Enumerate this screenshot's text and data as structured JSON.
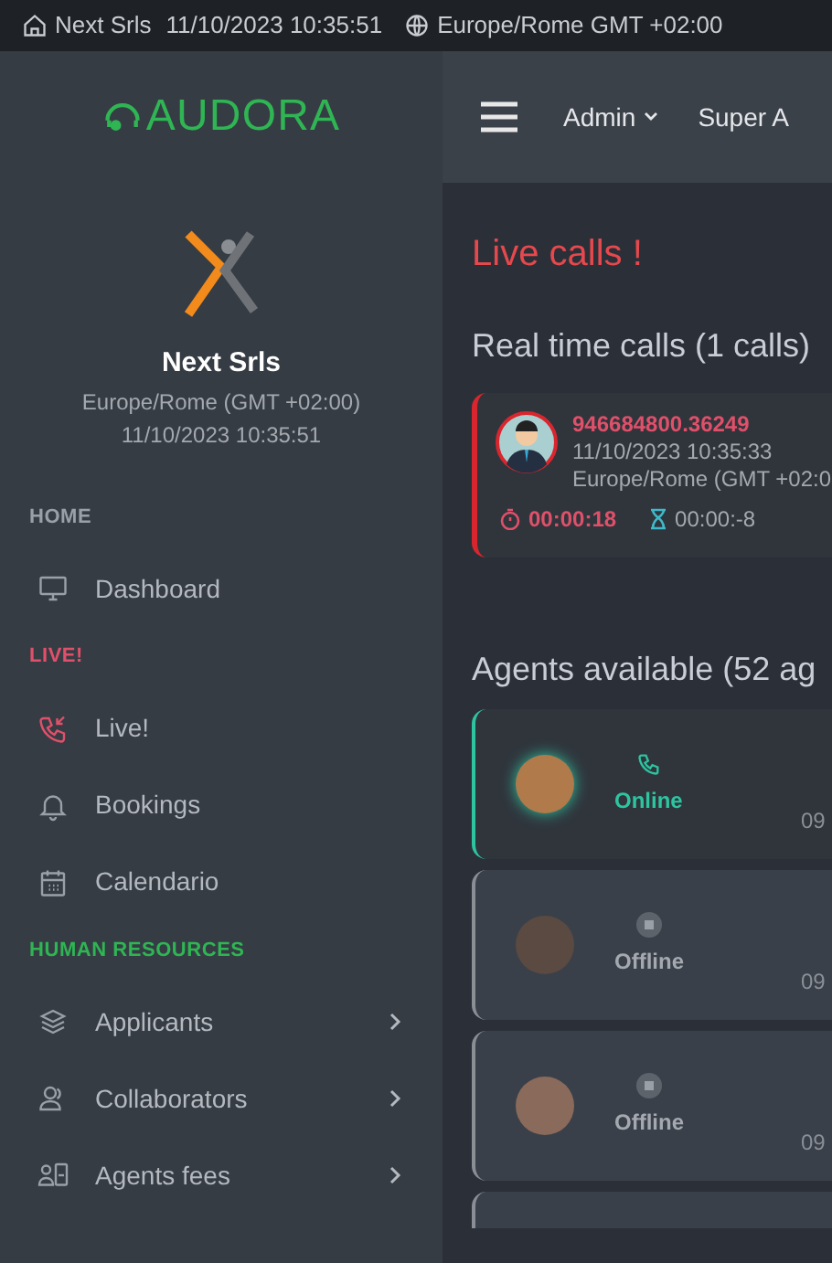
{
  "top_bar": {
    "company": "Next Srls",
    "datetime": "11/10/2023 10:35:51",
    "timezone": "Europe/Rome GMT +02:00"
  },
  "sidebar": {
    "logo": "AUDORA",
    "company": "Next Srls",
    "timezone": "Europe/Rome (GMT +02:00)",
    "datetime": "11/10/2023 10:35:51",
    "sections": [
      {
        "heading": "HOME",
        "color": "#9aa0a8",
        "items": [
          {
            "label": "Dashboard",
            "expandable": false,
            "alert": false
          }
        ]
      },
      {
        "heading": "LIVE!",
        "color": "#e0506a",
        "items": [
          {
            "label": "Live!",
            "expandable": false,
            "alert": true
          },
          {
            "label": "Bookings",
            "expandable": false,
            "alert": false
          },
          {
            "label": "Calendario",
            "expandable": false,
            "alert": false
          }
        ]
      },
      {
        "heading": "HUMAN RESOURCES",
        "color": "#2fb553",
        "items": [
          {
            "label": "Applicants",
            "expandable": true,
            "alert": false
          },
          {
            "label": "Collaborators",
            "expandable": true,
            "alert": false
          },
          {
            "label": "Agents fees",
            "expandable": true,
            "alert": false
          }
        ]
      }
    ]
  },
  "header": {
    "menus": [
      {
        "label": "Admin",
        "dropdown": true
      },
      {
        "label": "Super A",
        "dropdown": false
      }
    ]
  },
  "main": {
    "title": "Live calls !",
    "calls_heading": "Real time calls (1 calls)",
    "calls": [
      {
        "number": "946684800.36249",
        "datetime": "11/10/2023 10:35:33",
        "timezone": "Europe/Rome (GMT +02:0",
        "elapsed": "00:00:18",
        "remaining": "00:00:-8"
      }
    ],
    "agents_heading": "Agents available (52 ag",
    "agents": [
      {
        "online": true,
        "label": "Online",
        "time": "09"
      },
      {
        "online": false,
        "label": "Offline",
        "time": "09"
      },
      {
        "online": false,
        "label": "Offline",
        "time": "09"
      }
    ]
  }
}
